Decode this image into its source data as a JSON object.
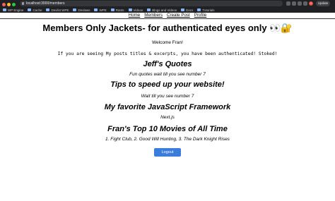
{
  "browser": {
    "url": "localhost:3000/members",
    "profile_initial": "G",
    "update_label": "Update",
    "bookmarks": [
      "WP Engine",
      "Cache",
      "Devlist WPE",
      "Devlaws",
      "WPE",
      "Rants",
      "Videos",
      "Blogs and Videos",
      "Docs",
      "Tutorials"
    ]
  },
  "nav": {
    "items": [
      "Home",
      "Members",
      "Create Post",
      "Profile"
    ]
  },
  "page": {
    "title": "Members Only Jackets- for authenticated eyes only 👀🔐",
    "welcome": "Welcome Fran!",
    "auth_message": "If you are seeing My posts titles & excerpts, you have been authenticated! Stoked!",
    "posts": [
      {
        "title": "Jeff's Quotes",
        "excerpt": "Fun quotes wait till you see number 7"
      },
      {
        "title": "Tips to speed up your website!",
        "excerpt": "Wait till you see number 7"
      },
      {
        "title": "My favorite JavaScript Framework",
        "excerpt": "Next.js"
      },
      {
        "title": "Fran's Top 10 Movies of All Time",
        "excerpt": "1. Fight Club, 2. Good Will Hunting, 3. The Dark Knight Rises"
      }
    ],
    "logout_label": "Logout"
  }
}
